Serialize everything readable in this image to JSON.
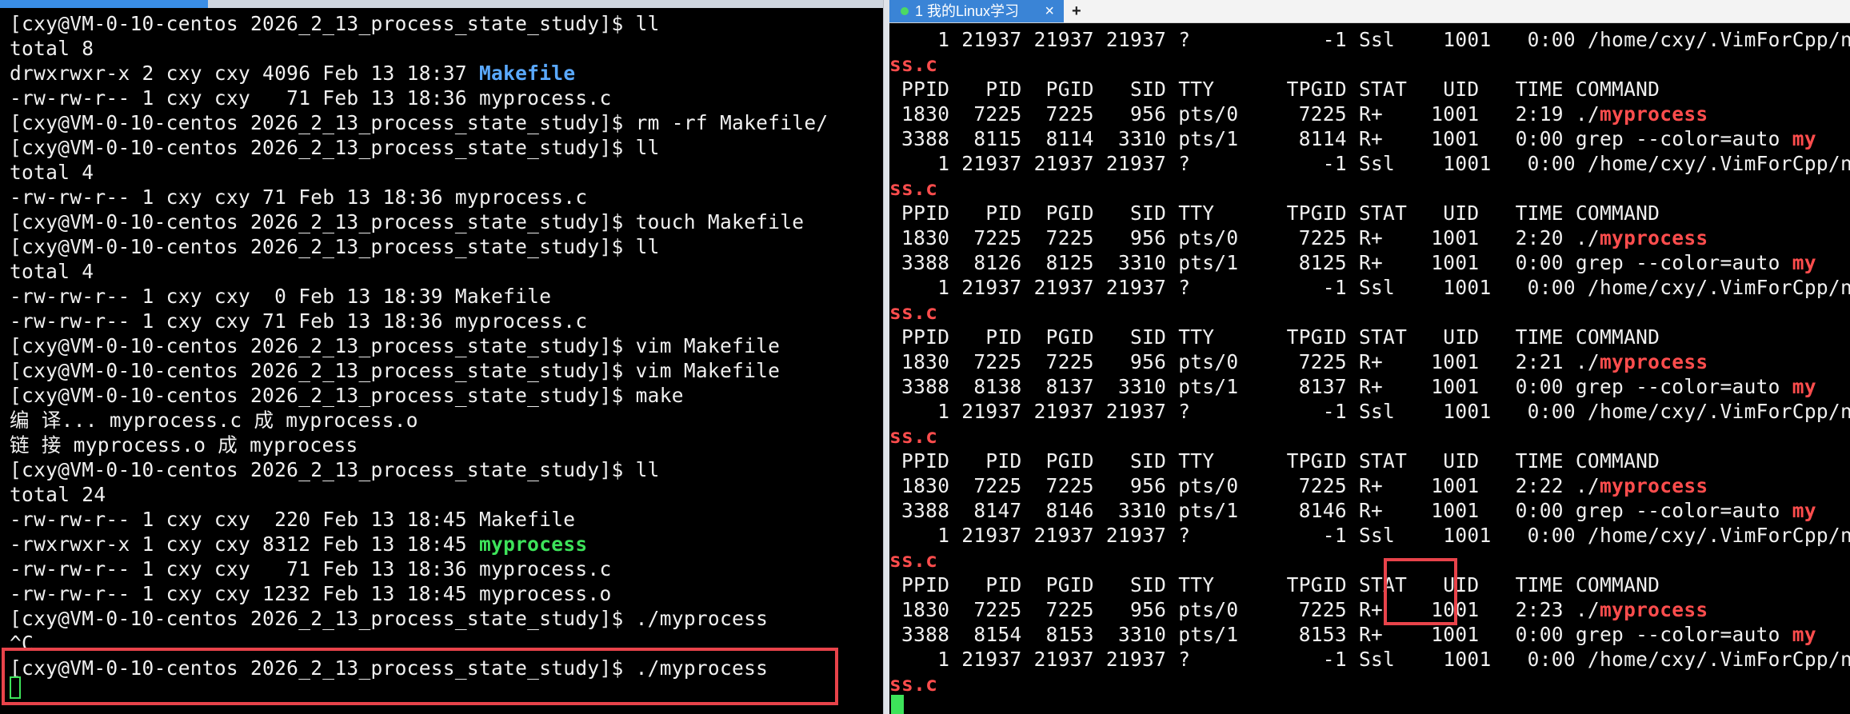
{
  "tab": {
    "label": "1 我的Linux学习",
    "close": "×",
    "add": "+"
  },
  "icons": {
    "tab_status": "dot-icon",
    "tab_close": "close-icon",
    "tab_add": "plus-icon"
  },
  "colors": {
    "highlight": "#e8434a",
    "dir": "#5aa9ff",
    "exec": "#3de35a",
    "match": "#ff4d4d",
    "tab": "#3a84d6"
  },
  "left_terminal": {
    "lines": [
      [
        {
          "t": "[cxy@VM-0-10-centos 2026_2_13_process_state_study]$ ll"
        }
      ],
      [
        {
          "t": "total 8"
        }
      ],
      [
        {
          "t": "drwxrwxr-x 2 cxy cxy 4096 Feb 13 18:37 "
        },
        {
          "t": "Makefile",
          "c": "blue"
        }
      ],
      [
        {
          "t": "-rw-rw-r-- 1 cxy cxy   71 Feb 13 18:36 myprocess.c"
        }
      ],
      [
        {
          "t": "[cxy@VM-0-10-centos 2026_2_13_process_state_study]$ rm -rf Makefile/"
        }
      ],
      [
        {
          "t": "[cxy@VM-0-10-centos 2026_2_13_process_state_study]$ ll"
        }
      ],
      [
        {
          "t": "total 4"
        }
      ],
      [
        {
          "t": "-rw-rw-r-- 1 cxy cxy 71 Feb 13 18:36 myprocess.c"
        }
      ],
      [
        {
          "t": "[cxy@VM-0-10-centos 2026_2_13_process_state_study]$ touch Makefile"
        }
      ],
      [
        {
          "t": "[cxy@VM-0-10-centos 2026_2_13_process_state_study]$ ll"
        }
      ],
      [
        {
          "t": "total 4"
        }
      ],
      [
        {
          "t": "-rw-rw-r-- 1 cxy cxy  0 Feb 13 18:39 Makefile"
        }
      ],
      [
        {
          "t": "-rw-rw-r-- 1 cxy cxy 71 Feb 13 18:36 myprocess.c"
        }
      ],
      [
        {
          "t": "[cxy@VM-0-10-centos 2026_2_13_process_state_study]$ vim Makefile"
        }
      ],
      [
        {
          "t": "[cxy@VM-0-10-centos 2026_2_13_process_state_study]$ vim Makefile"
        }
      ],
      [
        {
          "t": "[cxy@VM-0-10-centos 2026_2_13_process_state_study]$ make"
        }
      ],
      [
        {
          "t": "编 译... myprocess.c 成 myprocess.o"
        }
      ],
      [
        {
          "t": "链 接 myprocess.o 成 myprocess"
        }
      ],
      [
        {
          "t": "[cxy@VM-0-10-centos 2026_2_13_process_state_study]$ ll"
        }
      ],
      [
        {
          "t": "total 24"
        }
      ],
      [
        {
          "t": "-rw-rw-r-- 1 cxy cxy  220 Feb 13 18:45 Makefile"
        }
      ],
      [
        {
          "t": "-rwxrwxr-x 1 cxy cxy 8312 Feb 13 18:45 "
        },
        {
          "t": "myprocess",
          "c": "green"
        }
      ],
      [
        {
          "t": "-rw-rw-r-- 1 cxy cxy   71 Feb 13 18:36 myprocess.c"
        }
      ],
      [
        {
          "t": "-rw-rw-r-- 1 cxy cxy 1232 Feb 13 18:45 myprocess.o"
        }
      ],
      [
        {
          "t": "[cxy@VM-0-10-centos 2026_2_13_process_state_study]$ ./myprocess"
        }
      ],
      [
        {
          "t": "^C"
        }
      ],
      [
        {
          "t": "[cxy@VM-0-10-centos 2026_2_13_process_state_study]$ ./myprocess"
        }
      ]
    ]
  },
  "right_terminal": {
    "lines": [
      [
        {
          "t": "    1 21937 21937 21937 ?           -1 Ssl    1001   0:00 /home/cxy/.VimForCpp/n"
        }
      ],
      [
        {
          "t": "ss.c",
          "c": "red"
        }
      ],
      [
        {
          "t": " PPID   PID  PGID   SID TTY      TPGID STAT   UID   TIME COMMAND"
        }
      ],
      [
        {
          "t": " 1830  7225  7225   956 pts/0     7225 R+    1001   2:19 ./"
        },
        {
          "t": "myprocess",
          "c": "red"
        }
      ],
      [
        {
          "t": " 3388  8115  8114  3310 pts/1     8114 R+    1001   0:00 grep --color=auto "
        },
        {
          "t": "my",
          "c": "red"
        }
      ],
      [
        {
          "t": "    1 21937 21937 21937 ?           -1 Ssl    1001   0:00 /home/cxy/.VimForCpp/n"
        }
      ],
      [
        {
          "t": "ss.c",
          "c": "red"
        }
      ],
      [
        {
          "t": " PPID   PID  PGID   SID TTY      TPGID STAT   UID   TIME COMMAND"
        }
      ],
      [
        {
          "t": " 1830  7225  7225   956 pts/0     7225 R+    1001   2:20 ./"
        },
        {
          "t": "myprocess",
          "c": "red"
        }
      ],
      [
        {
          "t": " 3388  8126  8125  3310 pts/1     8125 R+    1001   0:00 grep --color=auto "
        },
        {
          "t": "my",
          "c": "red"
        }
      ],
      [
        {
          "t": "    1 21937 21937 21937 ?           -1 Ssl    1001   0:00 /home/cxy/.VimForCpp/n"
        }
      ],
      [
        {
          "t": "ss.c",
          "c": "red"
        }
      ],
      [
        {
          "t": " PPID   PID  PGID   SID TTY      TPGID STAT   UID   TIME COMMAND"
        }
      ],
      [
        {
          "t": " 1830  7225  7225   956 pts/0     7225 R+    1001   2:21 ./"
        },
        {
          "t": "myprocess",
          "c": "red"
        }
      ],
      [
        {
          "t": " 3388  8138  8137  3310 pts/1     8137 R+    1001   0:00 grep --color=auto "
        },
        {
          "t": "my",
          "c": "red"
        }
      ],
      [
        {
          "t": "    1 21937 21937 21937 ?           -1 Ssl    1001   0:00 /home/cxy/.VimForCpp/n"
        }
      ],
      [
        {
          "t": "ss.c",
          "c": "red"
        }
      ],
      [
        {
          "t": " PPID   PID  PGID   SID TTY      TPGID STAT   UID   TIME COMMAND"
        }
      ],
      [
        {
          "t": " 1830  7225  7225   956 pts/0     7225 R+    1001   2:22 ./"
        },
        {
          "t": "myprocess",
          "c": "red"
        }
      ],
      [
        {
          "t": " 3388  8147  8146  3310 pts/1     8146 R+    1001   0:00 grep --color=auto "
        },
        {
          "t": "my",
          "c": "red"
        }
      ],
      [
        {
          "t": "    1 21937 21937 21937 ?           -1 Ssl    1001   0:00 /home/cxy/.VimForCpp/n"
        }
      ],
      [
        {
          "t": "ss.c",
          "c": "red"
        }
      ],
      [
        {
          "t": " PPID   PID  PGID   SID TTY      TPGID STAT   UID   TIME COMMAND"
        }
      ],
      [
        {
          "t": " 1830  7225  7225   956 pts/0     7225 R+    1001   2:23 ./"
        },
        {
          "t": "myprocess",
          "c": "red"
        }
      ],
      [
        {
          "t": " 3388  8154  8153  3310 pts/1     8153 R+    1001   0:00 grep --color=auto "
        },
        {
          "t": "my",
          "c": "red"
        }
      ],
      [
        {
          "t": "    1 21937 21937 21937 ?           -1 Ssl    1001   0:00 /home/cxy/.VimForCpp/n"
        }
      ],
      [
        {
          "t": "ss.c",
          "c": "red"
        }
      ]
    ]
  }
}
